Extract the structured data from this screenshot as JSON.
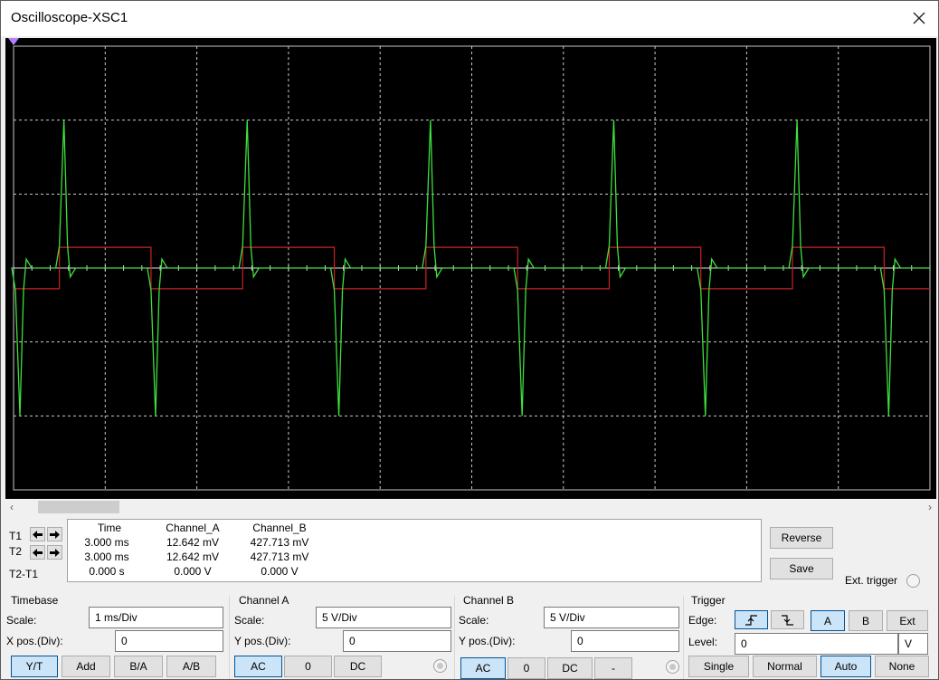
{
  "window": {
    "title": "Oscilloscope-XSC1"
  },
  "colors": {
    "channel_a": "#3de03d",
    "channel_b": "#cc2222",
    "grid": "#c8c8c8",
    "screen_bg": "#000000"
  },
  "chart_data": {
    "type": "line",
    "grid": true,
    "divisions": {
      "x": 10,
      "y": 6
    },
    "time_per_div_ms": 1,
    "x_range_div": [
      0,
      10
    ],
    "series": [
      {
        "name": "Channel_A",
        "shape": "spike train (differentiated square wave)",
        "period_div": 2,
        "positive_spike_div": 2.0,
        "negative_spike_div": -2.0,
        "rising_edges_div": [
          0.5,
          2.5,
          4.5,
          6.5,
          8.5
        ],
        "falling_edges_div": [
          1.5,
          3.5,
          5.5,
          7.5,
          9.5
        ]
      },
      {
        "name": "Channel_B",
        "shape": "square wave",
        "period_div": 2,
        "high_div": 0.28,
        "low_div": -0.28,
        "rising_edges_div": [
          0.5,
          2.5,
          4.5,
          6.5,
          8.5
        ],
        "falling_edges_div": [
          1.5,
          3.5,
          5.5,
          7.5,
          9.5
        ]
      }
    ]
  },
  "cursors": {
    "rows": [
      "T1",
      "T2",
      "T2-T1"
    ],
    "headers": [
      "Time",
      "Channel_A",
      "Channel_B"
    ],
    "t1": [
      "3.000 ms",
      "12.642 mV",
      "427.713 mV"
    ],
    "t2": [
      "3.000 ms",
      "12.642 mV",
      "427.713 mV"
    ],
    "diff": [
      "0.000 s",
      "0.000 V",
      "0.000 V"
    ]
  },
  "side_buttons": {
    "reverse": "Reverse",
    "save": "Save",
    "ext_trigger": "Ext. trigger"
  },
  "timebase": {
    "title": "Timebase",
    "scale_label": "Scale:",
    "scale_value": "1 ms/Div",
    "xpos_label": "X pos.(Div):",
    "xpos_value": "0",
    "modes": [
      "Y/T",
      "Add",
      "B/A",
      "A/B"
    ],
    "selected_mode": "Y/T"
  },
  "channel_a": {
    "title": "Channel A",
    "scale_label": "Scale:",
    "scale_value": "5  V/Div",
    "ypos_label": "Y pos.(Div):",
    "ypos_value": "0",
    "coupling": [
      "AC",
      "0",
      "DC"
    ],
    "selected_coupling": "AC"
  },
  "channel_b": {
    "title": "Channel B",
    "scale_label": "Scale:",
    "scale_value": "5  V/Div",
    "ypos_label": "Y pos.(Div):",
    "ypos_value": "0",
    "coupling": [
      "AC",
      "0",
      "DC",
      "-"
    ],
    "selected_coupling": "AC"
  },
  "trigger": {
    "title": "Trigger",
    "edge_label": "Edge:",
    "sources": [
      "A",
      "B",
      "Ext"
    ],
    "selected_source": "A",
    "level_label": "Level:",
    "level_value": "0",
    "level_unit": "V",
    "modes": [
      "Single",
      "Normal",
      "Auto",
      "None"
    ],
    "selected_mode": "Auto"
  }
}
